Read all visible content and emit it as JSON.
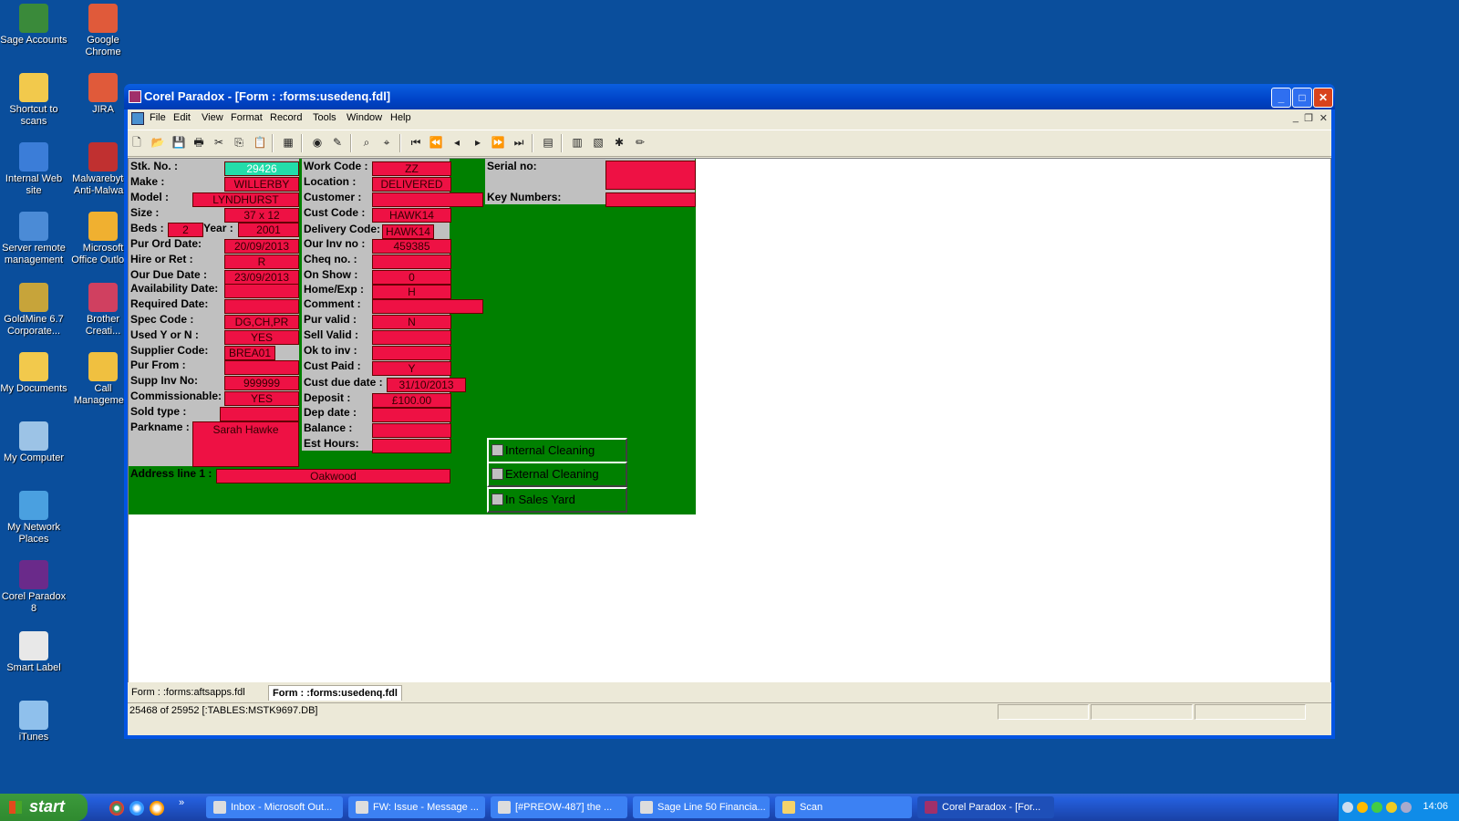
{
  "desktop": {
    "icons_left": [
      "Sage Accounts",
      "Shortcut to scans",
      "Internal Web site",
      "Server remote management",
      "GoldMine 6.7 Corporate...",
      "My Documents",
      "My Computer",
      "My Network Places",
      "Corel Paradox 8",
      "Smart Label",
      "iTunes"
    ],
    "icons_right": [
      "Google Chrome",
      "JIRA",
      "Malwarebytes Anti-Malware",
      "Microsoft Office Outlook",
      "Brother Creati...",
      "Call Manageme..."
    ]
  },
  "window": {
    "title": "Corel Paradox - [Form : :forms:usedenq.fdl]",
    "menu": [
      "File",
      "Edit",
      "View",
      "Format",
      "Record",
      "Tools",
      "Window",
      "Help"
    ]
  },
  "form": {
    "stk_no": {
      "label": "Stk. No. :",
      "value": "29426"
    },
    "make": {
      "label": "Make :",
      "value": "WILLERBY"
    },
    "model": {
      "label": "Model :",
      "value": "LYNDHURST"
    },
    "size": {
      "label": "Size :",
      "value": "37 x 12"
    },
    "beds": {
      "label": "Beds :",
      "value": "2"
    },
    "year": {
      "label": "Year :",
      "value": "2001"
    },
    "pur_ord_date": {
      "label": "Pur Ord Date:",
      "value": "20/09/2013"
    },
    "hire_or_ret": {
      "label": "Hire or Ret :",
      "value": "R"
    },
    "our_due_date": {
      "label": "Our Due Date :",
      "value": "23/09/2013"
    },
    "availability_date": {
      "label": "Availability Date:",
      "value": ""
    },
    "required_date": {
      "label": "Required Date:",
      "value": ""
    },
    "spec_code": {
      "label": "Spec Code :",
      "value": "DG,CH,PR"
    },
    "used_y_or_n": {
      "label": "Used Y or N :",
      "value": "YES"
    },
    "supplier_code": {
      "label": "Supplier Code:",
      "value": "BREA01"
    },
    "pur_from": {
      "label": "Pur From :",
      "value": ""
    },
    "supp_inv_no": {
      "label": "Supp Inv  No:",
      "value": "999999"
    },
    "commissionable": {
      "label": "Commissionable:",
      "value": "YES"
    },
    "sold_type": {
      "label": "Sold type :",
      "value": ""
    },
    "parkname": {
      "label": "Parkname :",
      "value": "Sarah Hawke"
    },
    "address_line_1": {
      "label": "Address line 1 :",
      "value": "Oakwood"
    },
    "work_code": {
      "label": "Work Code :",
      "value": "ZZ"
    },
    "location": {
      "label": "Location :",
      "value": "DELIVERED"
    },
    "customer": {
      "label": "Customer :",
      "value": ""
    },
    "cust_code": {
      "label": "Cust Code :",
      "value": "HAWK14"
    },
    "delivery_code": {
      "label": "Delivery Code:",
      "value": "HAWK14"
    },
    "our_inv_no": {
      "label": "Our Inv no :",
      "value": "459385"
    },
    "cheq_no": {
      "label": "Cheq no. :",
      "value": ""
    },
    "on_show": {
      "label": "On Show :",
      "value": "0"
    },
    "home_exp": {
      "label": "Home/Exp :",
      "value": "H"
    },
    "comment": {
      "label": "Comment :",
      "value": ""
    },
    "pur_valid": {
      "label": "Pur valid :",
      "value": "N"
    },
    "sell_valid": {
      "label": "Sell Valid :",
      "value": ""
    },
    "ok_to_inv": {
      "label": "Ok to inv :",
      "value": ""
    },
    "cust_paid": {
      "label": "Cust Paid :",
      "value": "Y"
    },
    "cust_due_date": {
      "label": "Cust due date :",
      "value": "31/10/2013"
    },
    "deposit": {
      "label": "Deposit :",
      "value": "£100.00"
    },
    "dep_date": {
      "label": "Dep date :",
      "value": ""
    },
    "balance": {
      "label": "Balance :",
      "value": ""
    },
    "est_hours": {
      "label": "Est Hours:",
      "value": ""
    },
    "serial_no": {
      "label": "Serial no:",
      "value": ""
    },
    "key_numbers": {
      "label": "Key Numbers:",
      "value": ""
    },
    "checkboxes": [
      "Internal Cleaning",
      "External Cleaning",
      "In Sales Yard"
    ]
  },
  "tabs": [
    "Form : :forms:aftsapps.fdl",
    "Form : :forms:usedenq.fdl"
  ],
  "status": "25468 of 25952 [:TABLES:MSTK9697.DB]",
  "taskbar": {
    "start": "start",
    "tasks": [
      "Inbox - Microsoft Out...",
      "FW: Issue - Message ...",
      "[#PREOW-487] the ...",
      "Sage Line 50 Financia...",
      "Scan",
      "Corel Paradox - [For..."
    ],
    "clock": "14:06"
  }
}
